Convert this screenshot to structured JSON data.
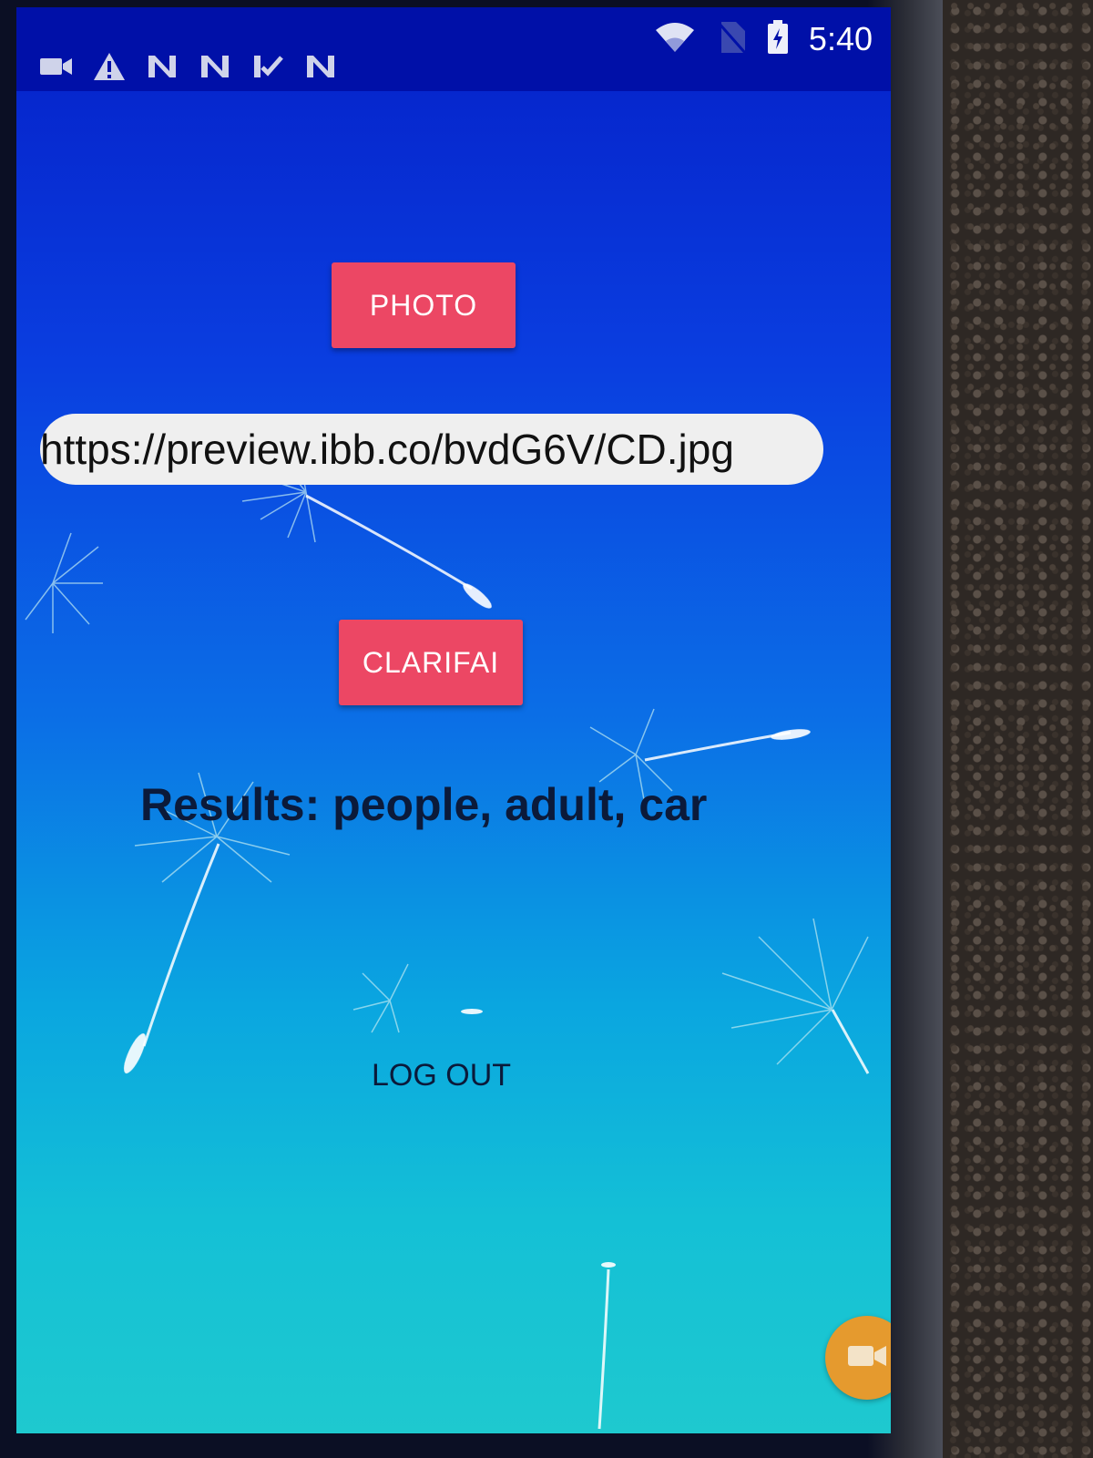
{
  "status_bar": {
    "time": "5:40",
    "left_icons": [
      "video-camera-icon",
      "warning-icon",
      "n-notification-icon",
      "n-notification-icon",
      "check-notification-icon",
      "n-notification-icon"
    ],
    "right_icons": [
      "wifi-icon",
      "no-sim-icon",
      "battery-charging-icon"
    ]
  },
  "main": {
    "photo_button_label": "PHOTO",
    "url_value": "https://preview.ibb.co/bvdG6V/CD.jpg",
    "clarifai_button_label": "CLARIFAI",
    "results_text": "Results: people, adult, car",
    "logout_button_label": "LOG OUT"
  },
  "overlay": {
    "floating_button_icon": "video-camera-icon"
  },
  "colors": {
    "button_accent": "#ec4764",
    "status_bar": "#0010a8",
    "floating_button": "#e59a2e"
  }
}
